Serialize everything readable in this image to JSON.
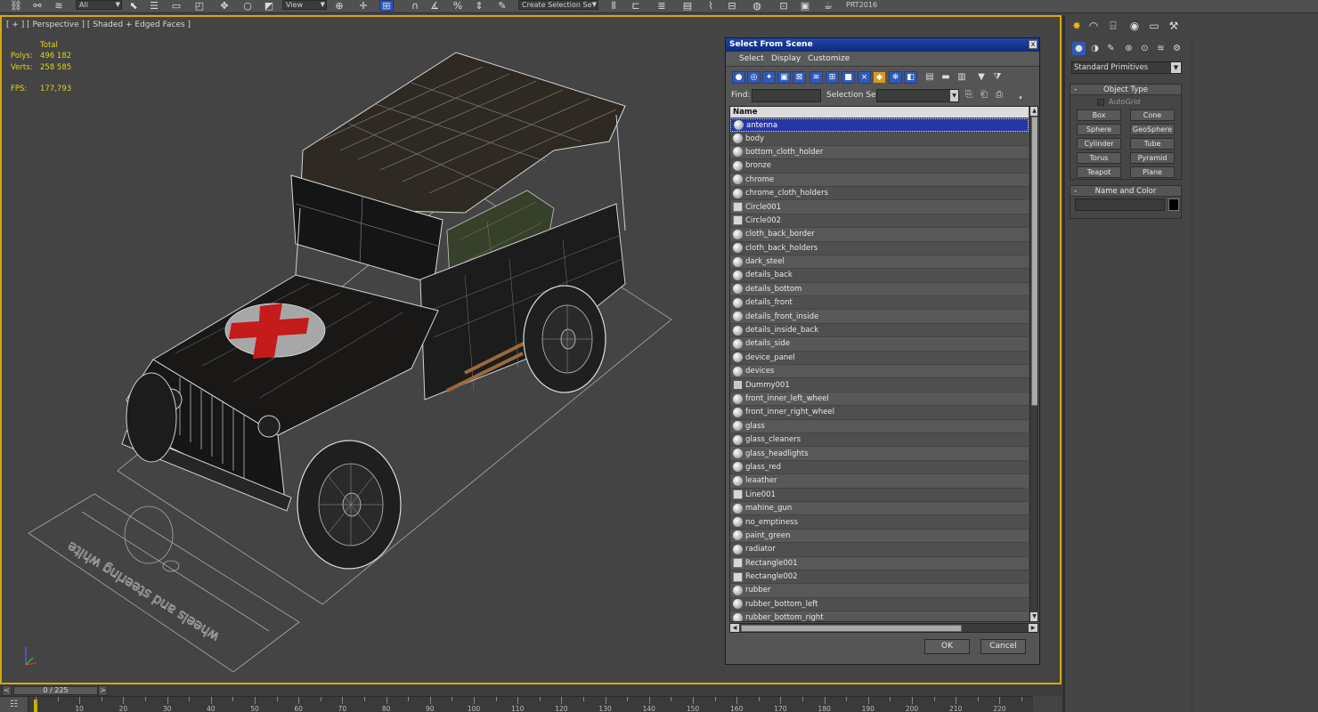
{
  "toolbar": {
    "filter_value": "All",
    "refcoord_value": "View",
    "selset_value": "Create Selection Se",
    "render_preset": "PRT2016"
  },
  "viewport": {
    "label": "[ + ] [ Perspective ] [ Shaded + Edged Faces ]",
    "stats": {
      "total_label": "Total",
      "polys_label": "Polys:",
      "polys_value": "496 182",
      "verts_label": "Verts:",
      "verts_value": "258 585",
      "fps_label": "FPS:",
      "fps_value": "177,793"
    },
    "ground_text": "wheels and steering white",
    "colors": {
      "border": "#d4a80f",
      "stats": "#e1d31e",
      "cross": "#c41b1b"
    }
  },
  "timeline": {
    "slider": "0 / 225",
    "prev": "<",
    "next": ">",
    "ticks": [
      "10",
      "20",
      "30",
      "40",
      "50",
      "60",
      "70",
      "80",
      "90",
      "100",
      "110",
      "120",
      "130",
      "140",
      "150",
      "160",
      "170",
      "180",
      "190",
      "200",
      "210",
      "220"
    ]
  },
  "dialog": {
    "title": "Select From Scene",
    "close": "x",
    "menu": [
      "Select",
      "Display",
      "Customize"
    ],
    "find_label": "Find:",
    "selset_label": "Selection Set:",
    "column_name": "Name",
    "items": [
      {
        "name": "antenna",
        "kind": "geo",
        "selected": true
      },
      {
        "name": "body",
        "kind": "geo"
      },
      {
        "name": "bottom_cloth_holder",
        "kind": "geo"
      },
      {
        "name": "bronze",
        "kind": "geo"
      },
      {
        "name": "chrome",
        "kind": "geo"
      },
      {
        "name": "chrome_cloth_holders",
        "kind": "geo"
      },
      {
        "name": "Circle001",
        "kind": "shape"
      },
      {
        "name": "Circle002",
        "kind": "shape"
      },
      {
        "name": "cloth_back_border",
        "kind": "geo"
      },
      {
        "name": "cloth_back_holders",
        "kind": "geo"
      },
      {
        "name": "dark_steel",
        "kind": "geo"
      },
      {
        "name": "details_back",
        "kind": "geo"
      },
      {
        "name": "details_bottom",
        "kind": "geo"
      },
      {
        "name": "details_front",
        "kind": "geo"
      },
      {
        "name": "details_front_inside",
        "kind": "geo"
      },
      {
        "name": "details_inside_back",
        "kind": "geo"
      },
      {
        "name": "details_side",
        "kind": "geo"
      },
      {
        "name": "device_panel",
        "kind": "geo"
      },
      {
        "name": "devices",
        "kind": "geo"
      },
      {
        "name": "Dummy001",
        "kind": "helper"
      },
      {
        "name": "front_inner_left_wheel",
        "kind": "geo"
      },
      {
        "name": "front_inner_right_wheel",
        "kind": "geo"
      },
      {
        "name": "glass",
        "kind": "geo"
      },
      {
        "name": "glass_cleaners",
        "kind": "geo"
      },
      {
        "name": "glass_headlights",
        "kind": "geo"
      },
      {
        "name": "glass_red",
        "kind": "geo"
      },
      {
        "name": "leaather",
        "kind": "geo"
      },
      {
        "name": "Line001",
        "kind": "shape"
      },
      {
        "name": "mahine_gun",
        "kind": "geo"
      },
      {
        "name": "no_emptiness",
        "kind": "geo"
      },
      {
        "name": "paint_green",
        "kind": "geo"
      },
      {
        "name": "radiator",
        "kind": "geo"
      },
      {
        "name": "Rectangle001",
        "kind": "shape"
      },
      {
        "name": "Rectangle002",
        "kind": "shape"
      },
      {
        "name": "rubber",
        "kind": "geo"
      },
      {
        "name": "rubber_bottom_left",
        "kind": "geo"
      },
      {
        "name": "rubber_bottom_right",
        "kind": "geo"
      }
    ],
    "ok": "OK",
    "cancel": "Cancel",
    "colors": {
      "title": "#1a3c98",
      "selected_row": "#2636a6"
    }
  },
  "command_panel": {
    "category": "Standard Primitives",
    "object_type_title": "Object Type",
    "autogrid": "AutoGrid",
    "primitives": [
      "Box",
      "Cone",
      "Sphere",
      "GeoSphere",
      "Cylinder",
      "Tube",
      "Torus",
      "Pyramid",
      "Teapot",
      "Plane"
    ],
    "name_color_title": "Name and Color",
    "rollout_minus": "-"
  }
}
